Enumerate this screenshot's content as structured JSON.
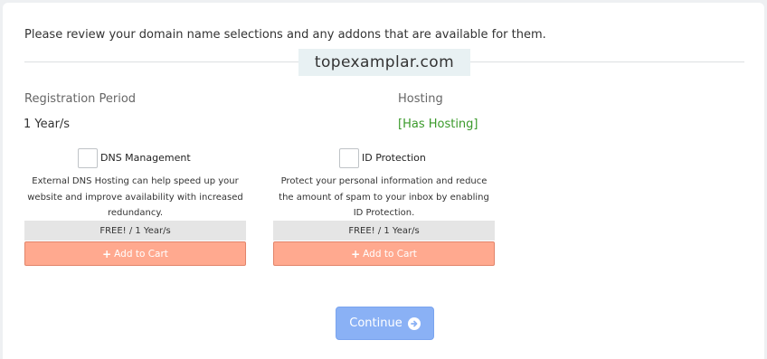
{
  "intro_text": "Please review your domain name selections and any addons that are available for them.",
  "domain": "topexamplar.com",
  "registration": {
    "label": "Registration Period",
    "value": "1 Year/s"
  },
  "hosting": {
    "label": "Hosting",
    "value": "[Has Hosting]",
    "value_color": "#3a9a2a"
  },
  "addons": [
    {
      "name": "DNS Management",
      "checked": false,
      "description": "External DNS Hosting can help speed up your website and improve availability with increased redundancy.",
      "price": "FREE! / 1 Year/s",
      "cart_label": "Add to Cart",
      "cart_icon": "plus-icon"
    },
    {
      "name": "ID Protection",
      "checked": false,
      "description": "Protect your personal information and reduce the amount of spam to your inbox by enabling ID Protection.",
      "price": "FREE! / 1 Year/s",
      "cart_label": "Add to Cart",
      "cart_icon": "plus-icon"
    }
  ],
  "continue": {
    "label": "Continue",
    "icon": "arrow-circle-right-icon",
    "color": "#8ab1f5"
  },
  "colors": {
    "cart_button": "#ffa98f",
    "price_bar": "#e5e5e5"
  }
}
